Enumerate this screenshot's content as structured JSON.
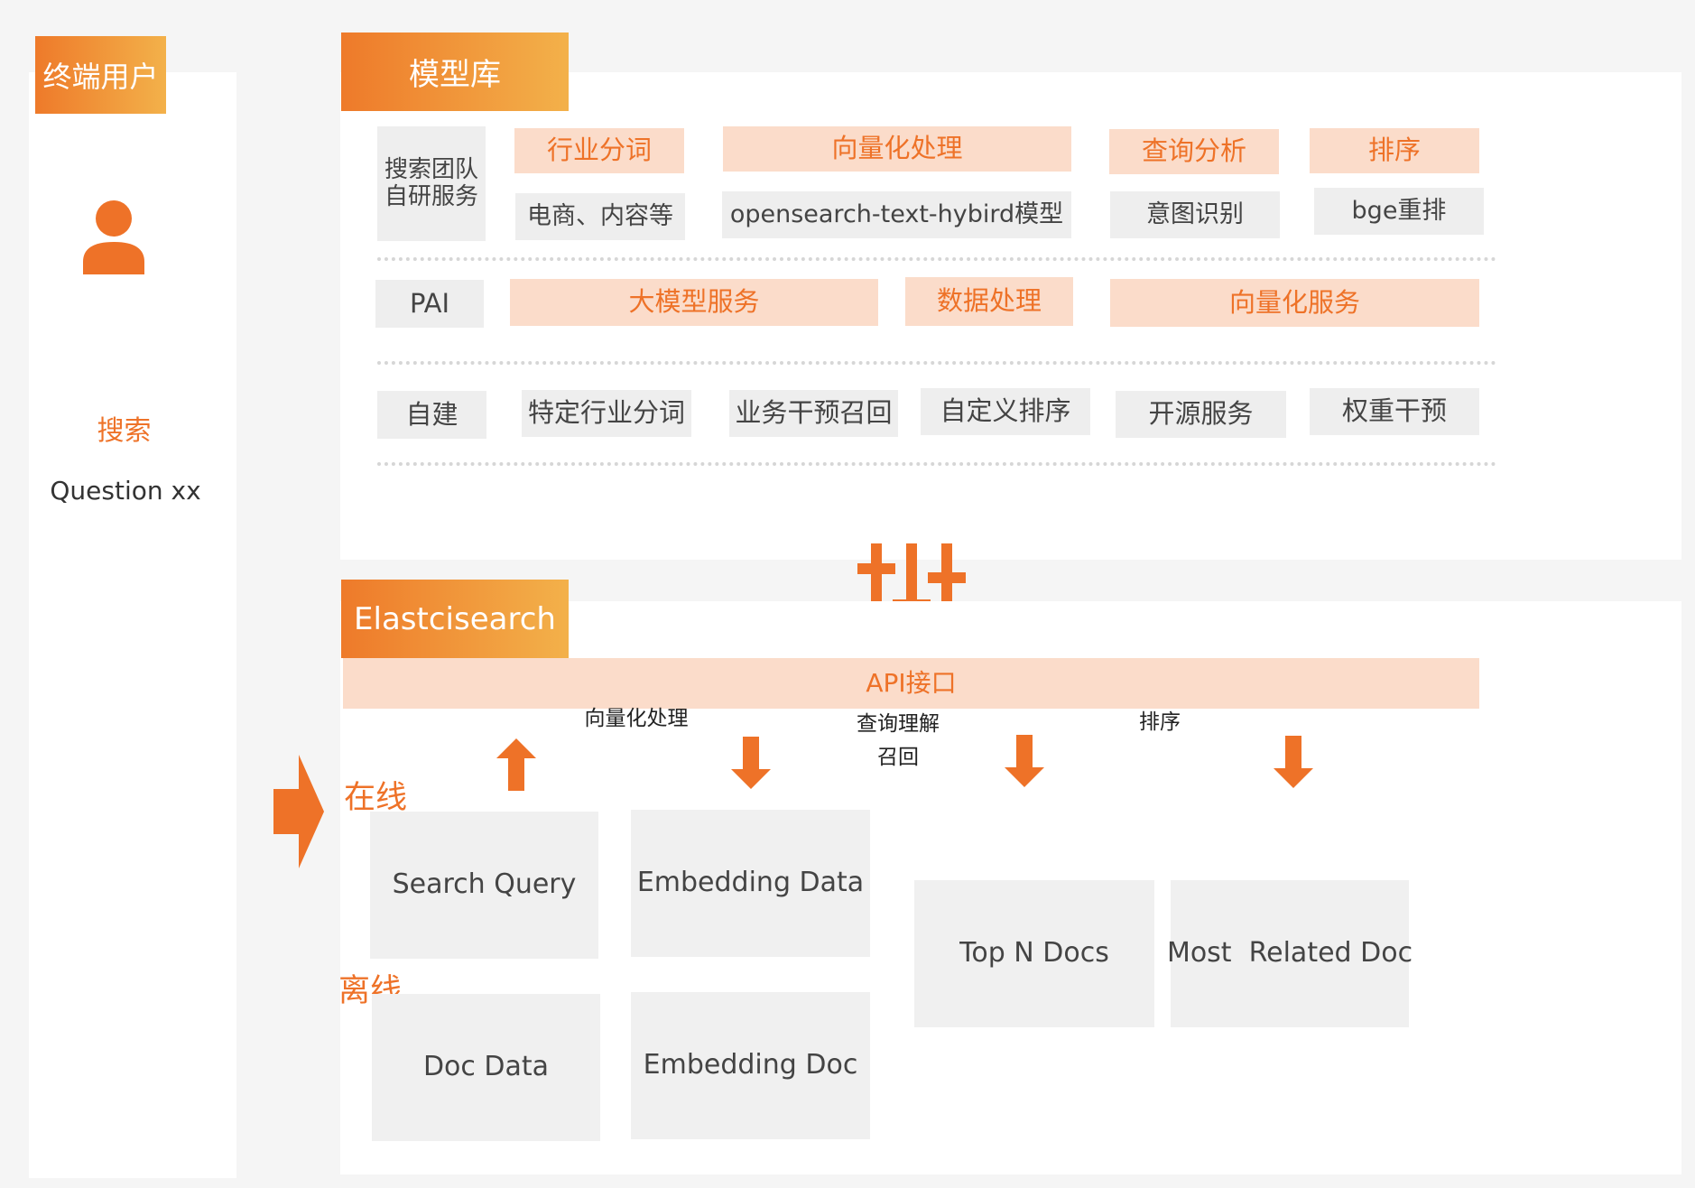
{
  "user": {
    "title": "终端用户",
    "search_label": "搜索",
    "question": "Question xx"
  },
  "model_lib": {
    "title": "模型库",
    "rows": [
      [
        {
          "text": "搜索团队\n自研服务"
        },
        {
          "text": "行业分词"
        },
        {
          "text": "电商、内容等"
        },
        {
          "text": "向量化处理"
        },
        {
          "text": "opensearch-text-hybird模型"
        },
        {
          "text": "查询分析"
        },
        {
          "text": "意图识别"
        },
        {
          "text": "排序"
        },
        {
          "text": "bge重排"
        }
      ],
      [
        {
          "text": "PAI"
        },
        {
          "text": "大模型服务"
        },
        {
          "text": "数据处理"
        },
        {
          "text": "向量化服务"
        }
      ],
      [
        {
          "text": "自建"
        },
        {
          "text": "特定行业分词"
        },
        {
          "text": "业务干预召回"
        },
        {
          "text": "自定义排序"
        },
        {
          "text": "开源服务"
        },
        {
          "text": "权重干预"
        }
      ]
    ]
  },
  "es": {
    "title": "Elastcisearch",
    "api": "API接口",
    "flow_labels": [
      "向量化处理",
      "查询理解",
      "召回",
      "排序"
    ],
    "online": "在线",
    "offline": "离线",
    "boxes": [
      "Search Query",
      "Embedding Data",
      "Top N Docs",
      "Most  Related Doc",
      "Doc Data",
      "Embedding Doc"
    ]
  },
  "colors": {
    "accent": "#ee7228",
    "tab_gradient_end": "#f3b14a",
    "soft_orange": "#fbdcca",
    "gray_cell": "#eeeeee"
  },
  "icons": [
    "user-icon",
    "sliders-icon",
    "arrow-up-icon",
    "arrow-down-icon",
    "arrow-right-icon"
  ]
}
